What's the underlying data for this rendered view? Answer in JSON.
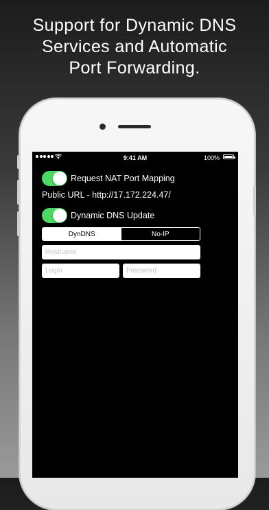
{
  "headline": {
    "lines": [
      "Support for Dynamic DNS",
      "Services and Automatic",
      "Port Forwarding."
    ]
  },
  "status_bar": {
    "time": "9:41 AM",
    "battery_percent": "100%",
    "signal_icon": "signal-dots-icon",
    "wifi_icon": "wifi-icon",
    "battery_icon": "battery-icon"
  },
  "settings": {
    "nat_toggle": {
      "label": "Request NAT Port Mapping",
      "on": true
    },
    "public_url": "Public URL - http://17.172.224.47/",
    "ddns_toggle": {
      "label": "Dynamic DNS Update",
      "on": true
    },
    "provider_tabs": [
      {
        "label": "DynDNS",
        "selected": true
      },
      {
        "label": "No-IP",
        "selected": false
      }
    ],
    "hostname": {
      "placeholder": "Hostname",
      "value": ""
    },
    "login": {
      "placeholder": "Login",
      "value": ""
    },
    "password": {
      "placeholder": "Password",
      "value": ""
    }
  },
  "colors": {
    "toggle_on": "#4cd964",
    "screen_bg": "#000000",
    "text": "#ffffff"
  }
}
